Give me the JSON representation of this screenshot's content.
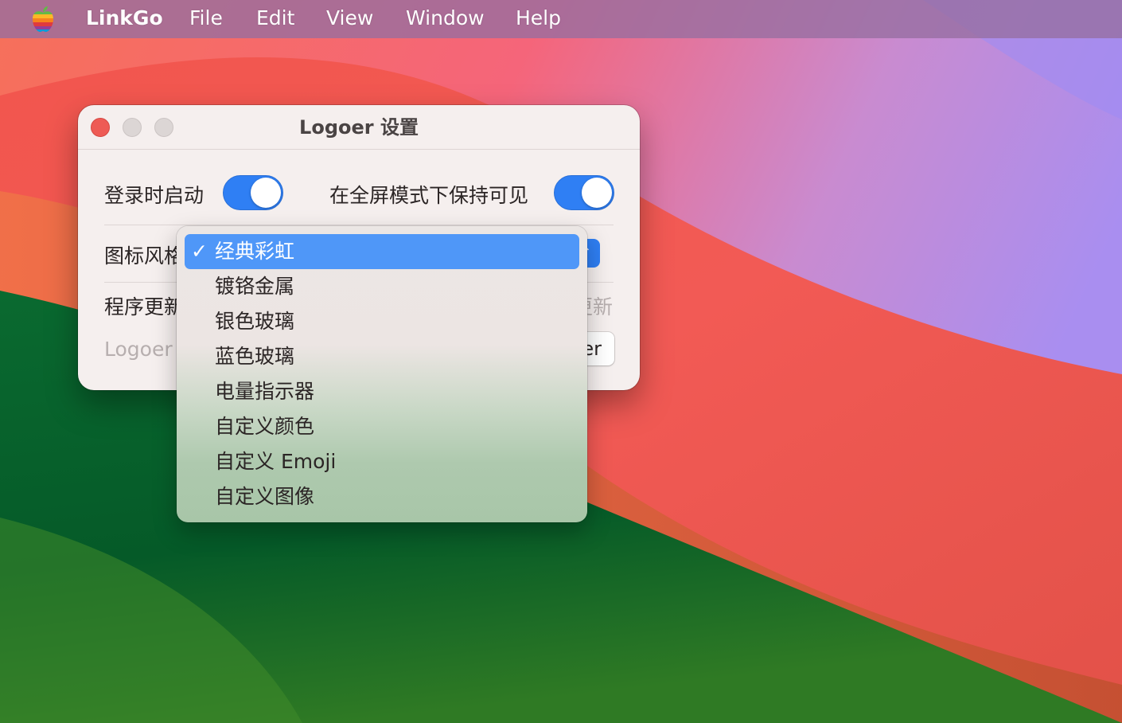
{
  "menubar": {
    "app_name": "LinkGo",
    "items": [
      "File",
      "Edit",
      "View",
      "Window",
      "Help"
    ]
  },
  "window": {
    "title": "Logoer 设置",
    "launch_at_login_label": "登录时启动",
    "launch_at_login_on": true,
    "fullscreen_visible_label": "在全屏模式下保持可见",
    "fullscreen_visible_on": true,
    "icon_style_label": "图标风格",
    "program_update_label": "程序更新",
    "update_value_fragment": "更新",
    "version_text_fragment": "Logoer",
    "button_text_fragment": "er"
  },
  "popup_menu": {
    "selected_index": 0,
    "check_glyph": "✓",
    "items": [
      "经典彩虹",
      "镀铬金属",
      "银色玻璃",
      "蓝色玻璃",
      "电量指示器",
      "自定义颜色",
      "自定义 Emoji",
      "自定义图像"
    ]
  },
  "colors": {
    "accent": "#2f7ff4",
    "menu_highlight": "#4f97f8",
    "close_button": "#ee5b55"
  }
}
